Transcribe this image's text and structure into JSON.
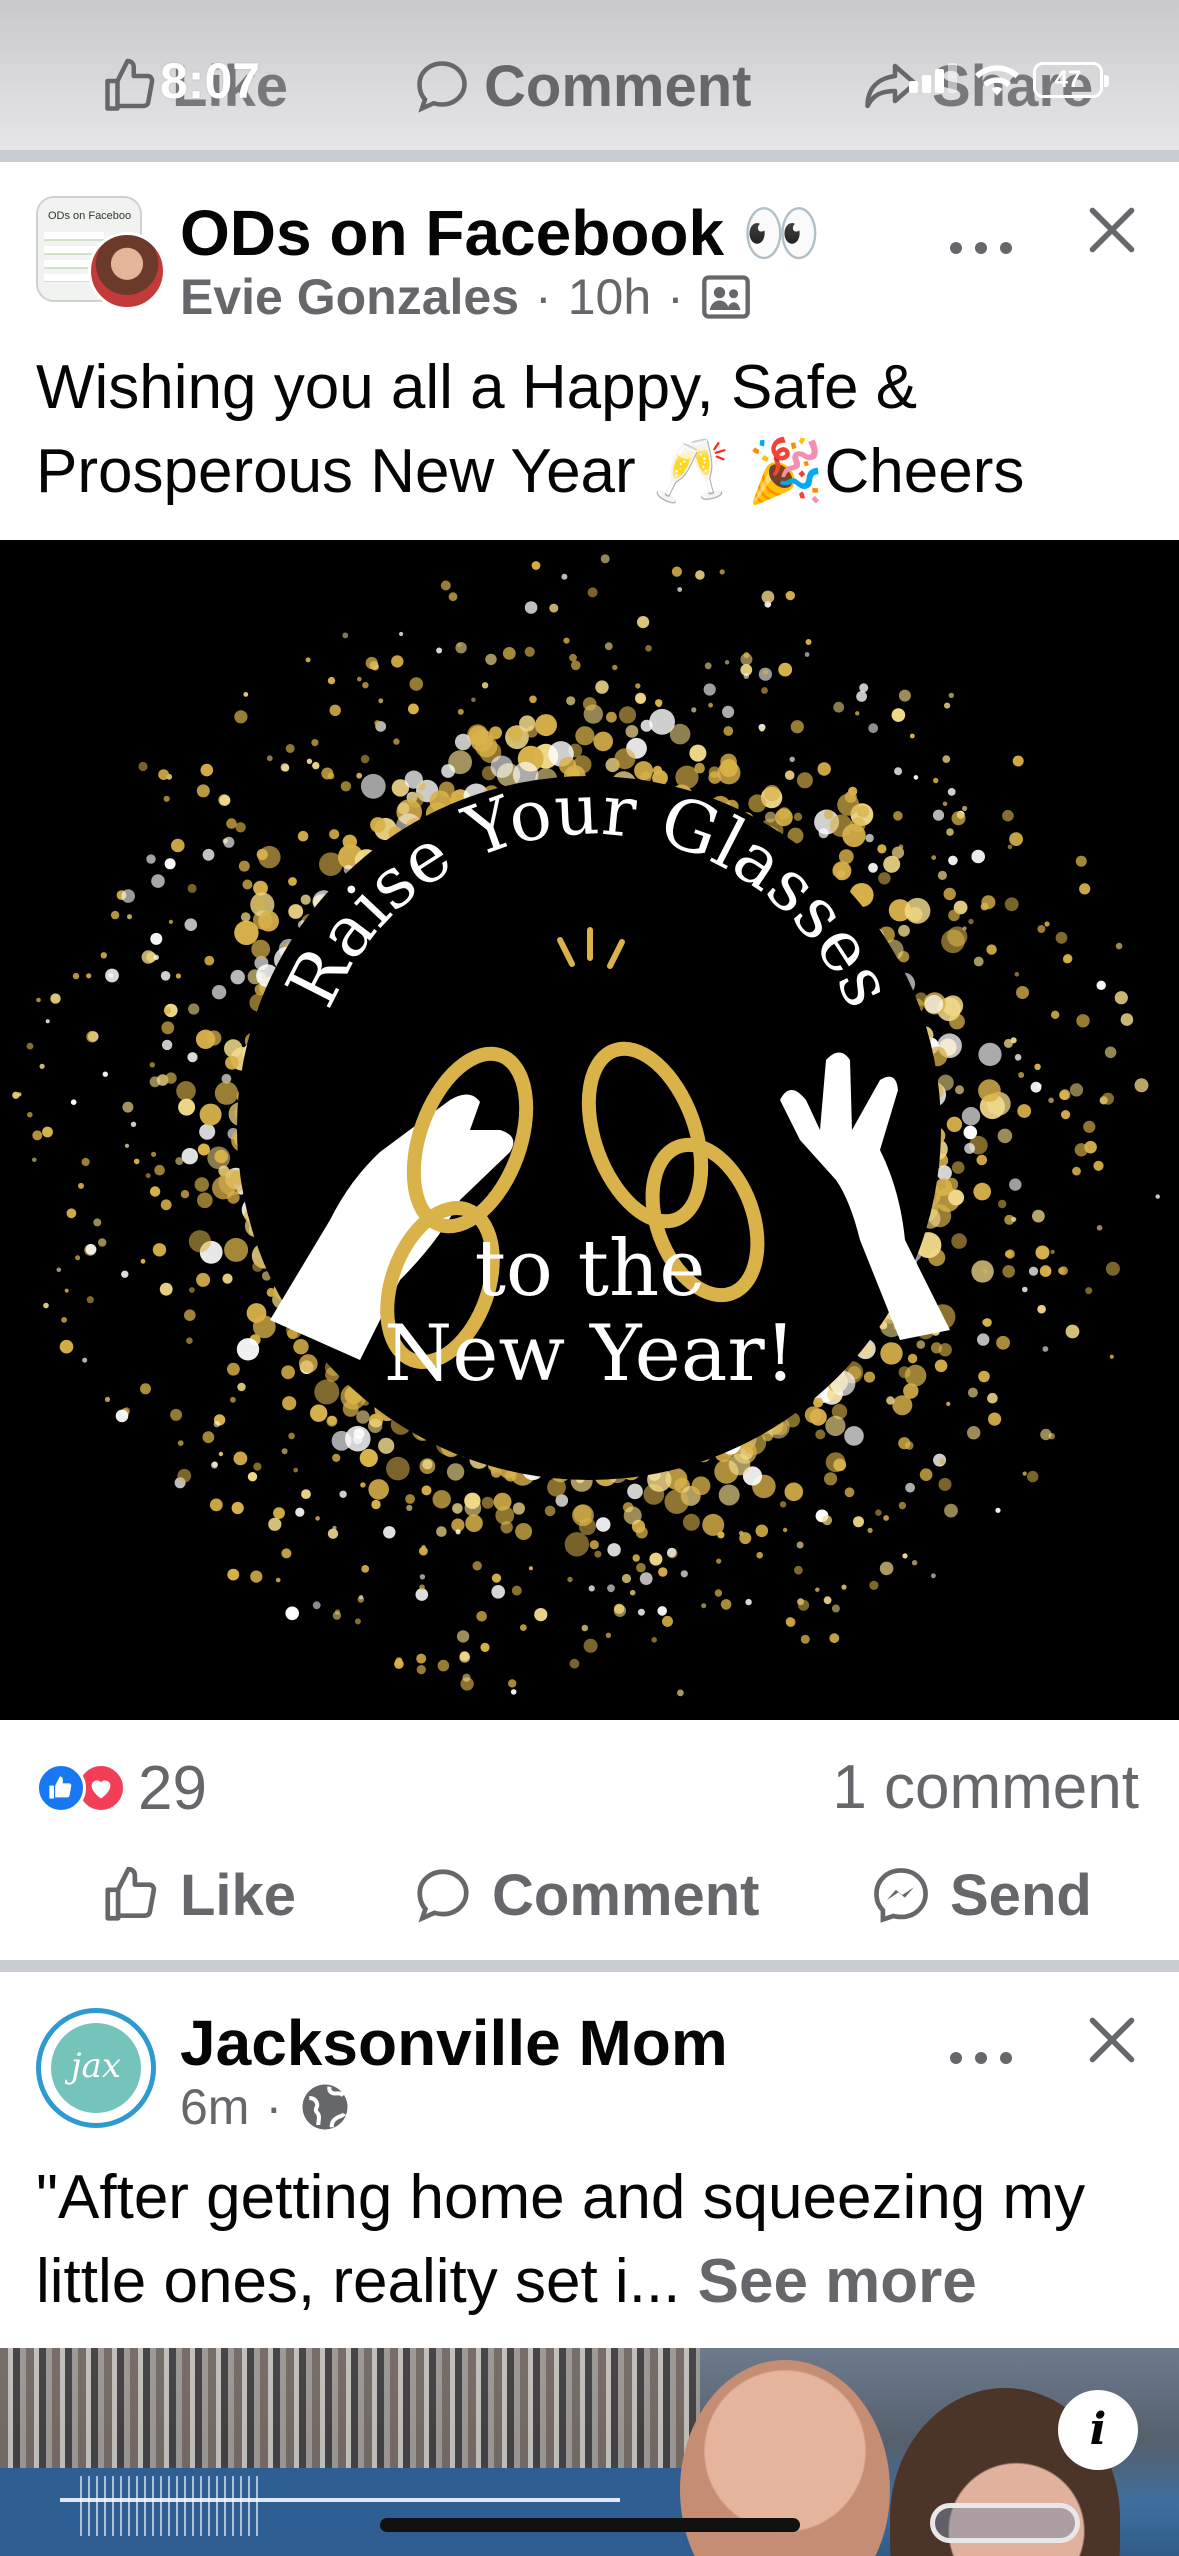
{
  "status_bar": {
    "time": "8:07",
    "battery": "47"
  },
  "top_actions": {
    "like": "Like",
    "comment": "Comment",
    "share": "Share"
  },
  "post1": {
    "group_name": "ODs on Facebook 👀",
    "group_avatar_text": "ODs on Faceboo",
    "author": "Evie Gonzales",
    "time": "10h",
    "text": "Wishing you all a Happy, Safe & Prosperous New Year 🥂 🎉Cheers",
    "image": {
      "arc_text": "Raise Your Glasses",
      "line1": "to the",
      "line2": "New Year!"
    },
    "reaction_count": "29",
    "comment_count": "1 comment",
    "actions": {
      "like": "Like",
      "comment": "Comment",
      "send": "Send"
    }
  },
  "post2": {
    "name": "Jacksonville Mom",
    "avatar_text": "jax",
    "time": "6m",
    "text": "\"After getting home and squeezing my little ones, reality set i...",
    "see_more": "See more",
    "info_button": "i"
  },
  "colors": {
    "meta_gray": "#65676b",
    "like_blue": "#1877f2",
    "love_red": "#f33e58",
    "gold": "#d9b24a"
  }
}
